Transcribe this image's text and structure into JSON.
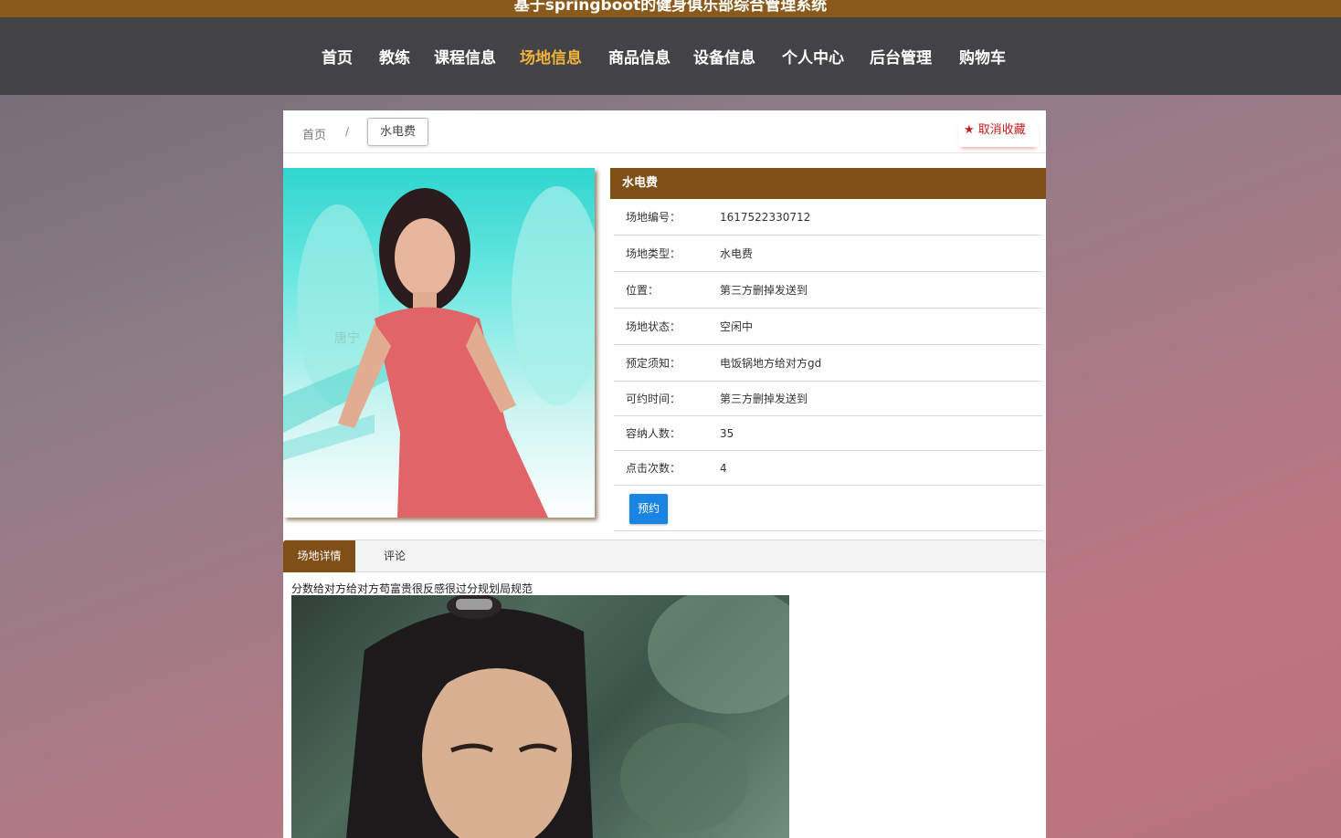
{
  "site_title": "基于springboot的健身俱乐部综合管理系统",
  "nav": [
    {
      "label": "首页",
      "active": false
    },
    {
      "label": "教练",
      "active": false
    },
    {
      "label": "课程信息",
      "active": false
    },
    {
      "label": "场地信息",
      "active": true
    },
    {
      "label": "商品信息",
      "active": false
    },
    {
      "label": "设备信息",
      "active": false
    },
    {
      "label": "个人中心",
      "active": false
    },
    {
      "label": "后台管理",
      "active": false
    },
    {
      "label": "购物车",
      "active": false
    }
  ],
  "breadcrumb": {
    "home": "首页",
    "separator": "/",
    "current": "水电费"
  },
  "favorite": {
    "icon": "star-icon",
    "label": "取消收藏"
  },
  "photo_caption": "唐宁",
  "detail": {
    "title": "水电费",
    "rows": [
      {
        "key": "场地编号：",
        "value": "1617522330712"
      },
      {
        "key": "场地类型：",
        "value": "水电费"
      },
      {
        "key": "位置：",
        "value": "第三方删掉发送到"
      },
      {
        "key": "场地状态：",
        "value": "空闲中"
      },
      {
        "key": "预定须知：",
        "value": "电饭锅地方给对方gd"
      },
      {
        "key": "可约时间：",
        "value": "第三方删掉发送到"
      },
      {
        "key": "容纳人数：",
        "value": "35"
      },
      {
        "key": "点击次数：",
        "value": "4"
      }
    ],
    "book_button": "预约"
  },
  "tabs": [
    {
      "label": "场地详情",
      "active": true
    },
    {
      "label": "评论",
      "active": false
    }
  ],
  "description": "分数给对方给对方苟富贵很反感很过分规划局规范",
  "colors": {
    "brand_brown": "#7f4f18",
    "nav_bg": "#434244",
    "nav_active": "#f0b43c",
    "button_blue": "#1a84e3",
    "favorite_red": "#c71b1b"
  }
}
